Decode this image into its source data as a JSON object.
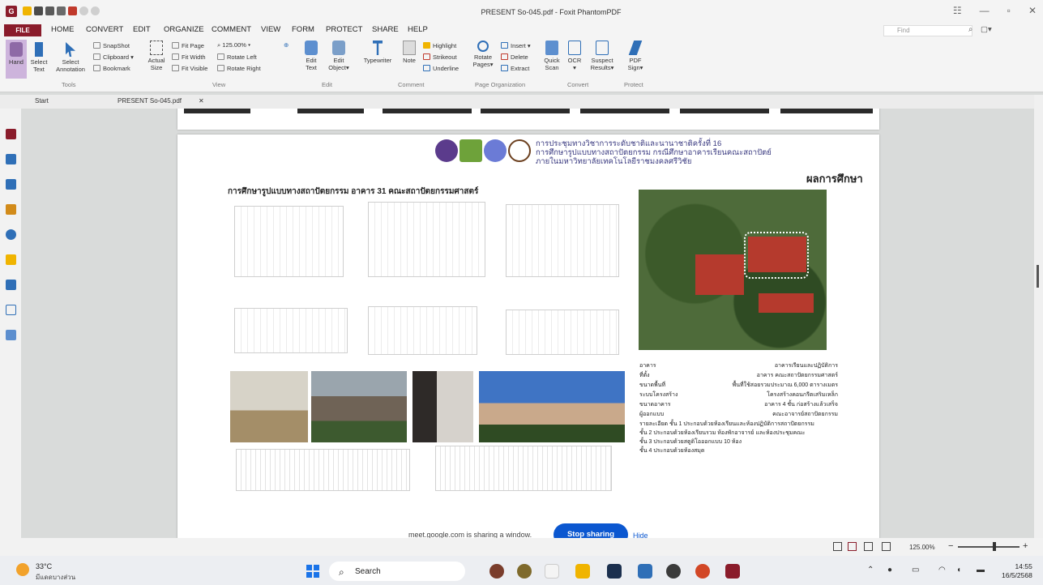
{
  "window": {
    "logo": "G",
    "title": "PRESENT So-045.pdf - Foxit PhantomPDF",
    "controls": [
      "☷",
      "—",
      "▫",
      "✕"
    ]
  },
  "ribbon_tabs": {
    "file": "FILE",
    "items": [
      "HOME",
      "CONVERT",
      "EDIT",
      "ORGANIZE",
      "COMMENT",
      "VIEW",
      "FORM",
      "PROTECT",
      "SHARE",
      "HELP"
    ],
    "find_placeholder": "Find"
  },
  "ribbon": {
    "hand": "Hand",
    "select_text": [
      "Select",
      "Text"
    ],
    "select_annotation": [
      "Select",
      "Annotation"
    ],
    "snapshot": "SnapShot",
    "clipboard": "Clipboard ▾",
    "bookmark": "Bookmark",
    "actual_size": [
      "Actual",
      "Size"
    ],
    "fit_page": "Fit Page",
    "fit_width": "Fit Width",
    "fit_visible": "Fit Visible",
    "zoom_value": "125.00%",
    "rotate_left": "Rotate Left",
    "rotate_right": "Rotate Right",
    "edit_text": [
      "Edit",
      "Text"
    ],
    "edit_object": [
      "Edit",
      "Object▾"
    ],
    "typewriter": "Typewriter",
    "note": "Note",
    "highlight": "Highlight",
    "strikeout": "Strikeout",
    "underline": "Underline",
    "rotate_pages": [
      "Rotate",
      "Pages▾"
    ],
    "insert": "Insert ▾",
    "delete": "Delete",
    "extract": "Extract",
    "quick_scan": [
      "Quick",
      "Scan"
    ],
    "ocr": [
      "OCR",
      "▾"
    ],
    "suspect_results": [
      "Suspect",
      "Results▾"
    ],
    "pdf_sign": [
      "PDF",
      "Sign▾"
    ],
    "groups": {
      "tools": "Tools",
      "view": "View",
      "edit": "Edit",
      "comment": "Comment",
      "page_organization": "Page Organization",
      "convert": "Convert",
      "protect": "Protect"
    }
  },
  "doc_tabs": {
    "start": "Start",
    "file": "PRESENT So-045.pdf",
    "close": "✕"
  },
  "page": {
    "header_lines": [
      "การประชุมทางวิชาการระดับชาติและนานาชาติครั้งที่ 16",
      "การศึกษารูปแบบทางสถาปัตยกรรม กรณีศึกษาอาคารเรียนคณะสถาปัตย์",
      "ภายในมหาวิทยาลัยเทคโนโลยีราชมงคลศรีวิชัย"
    ],
    "results_heading": "ผลการศึกษา",
    "title": "การศึกษารูปแบบทางสถาปัตยกรรม อาคาร 31 คณะสถาปัตยกรรมศาสตร์",
    "info_rows": [
      [
        "อาคาร",
        "อาคารเรียนและปฏิบัติการ"
      ],
      [
        "ที่ตั้ง",
        "อาคาร คณะสถาปัตยกรรมศาสตร์"
      ],
      [
        "ขนาดพื้นที่",
        "พื้นที่ใช้สอยรวมประมาณ 6,000 ตารางเมตร"
      ],
      [
        "ระบบโครงสร้าง",
        "โครงสร้างคอนกรีตเสริมเหล็ก"
      ],
      [
        "ขนาดอาคาร",
        "อาคาร 4 ชั้น ก่อสร้างแล้วเสร็จ"
      ],
      [
        "ผู้ออกแบบ",
        "คณะอาจารย์สถาปัตยกรรม"
      ]
    ],
    "info_lines": [
      "รายละเอียด ชั้น 1 ประกอบด้วยห้องเรียนและห้องปฏิบัติการสถาปัตยกรรม",
      "ชั้น 2 ประกอบด้วยห้องเรียนรวม ห้องพักอาจารย์ และห้องประชุมคณะ",
      "ชั้น 3 ประกอบด้วยสตูดิโอออกแบบ 10 ห้อง",
      "ชั้น 4 ประกอบด้วยห้องสมุด"
    ]
  },
  "sharing": {
    "message": "meet.google.com is sharing a window.",
    "stop": "Stop sharing",
    "hide": "Hide"
  },
  "statusbar": {
    "zoom": "125.00%",
    "minus": "−",
    "plus": "+"
  },
  "taskbar": {
    "temperature": "33°C",
    "weather": "มีแดดบางส่วน",
    "search_label": "Search",
    "time": "14:55",
    "date": "16/5/2568"
  },
  "colors": {
    "file_tab": "#8a1c2b",
    "stop_button": "#0b57d0",
    "roof": "#b53a2d"
  }
}
